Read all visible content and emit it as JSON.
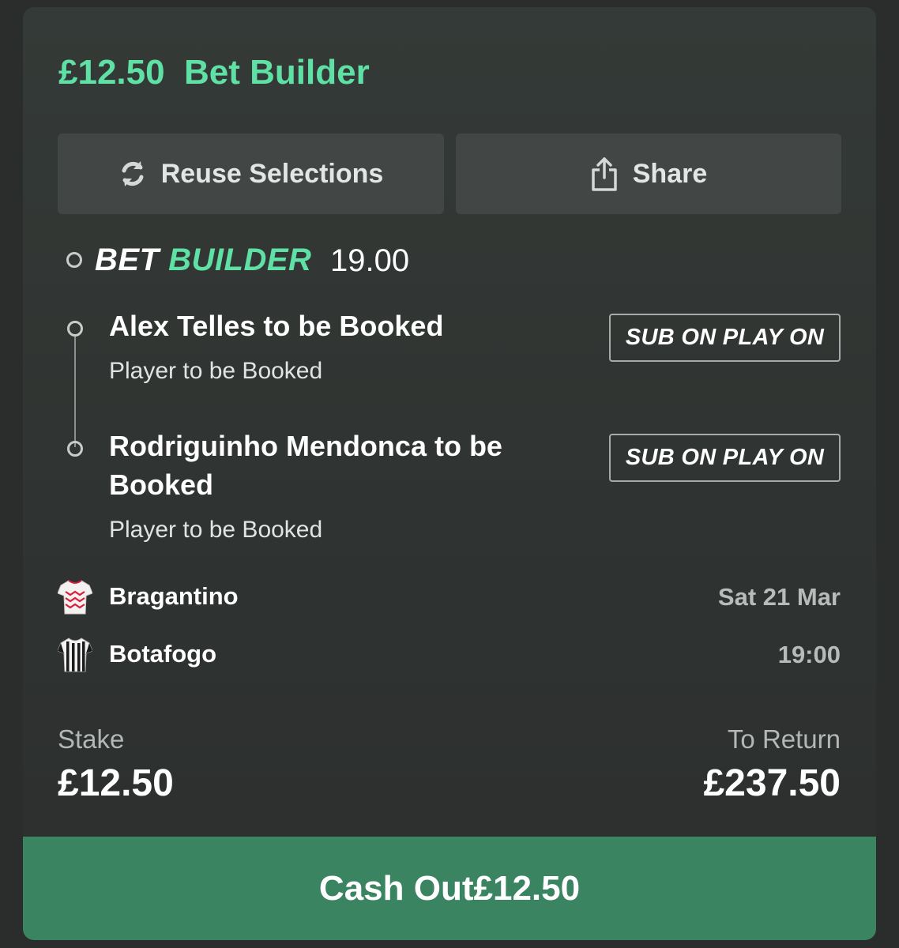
{
  "header": {
    "amount": "£12.50",
    "title": "Bet Builder"
  },
  "actions": {
    "reuse_label": "Reuse Selections",
    "share_label": "Share"
  },
  "bet_builder": {
    "logo_bet": "BET",
    "logo_builder": "BUILDER",
    "odds": "19.00"
  },
  "selections": [
    {
      "title": "Alex Telles to be Booked",
      "market": "Player to be Booked",
      "badge": "SUB ON PLAY ON"
    },
    {
      "title": "Rodriguinho Mendonca to be Booked",
      "market": "Player to be Booked",
      "badge": "SUB ON PLAY ON"
    }
  ],
  "match": {
    "home_team": "Bragantino",
    "away_team": "Botafogo",
    "date": "Sat 21 Mar",
    "time": "19:00"
  },
  "totals": {
    "stake_label": "Stake",
    "stake_value": "£12.50",
    "return_label": "To Return",
    "return_value": "£237.50"
  },
  "cashout": {
    "label": "Cash Out",
    "amount": "£12.50"
  },
  "colors": {
    "accent_green": "#5fe0a5",
    "cashout_green": "#3a8462",
    "card_bg": "#323734"
  }
}
